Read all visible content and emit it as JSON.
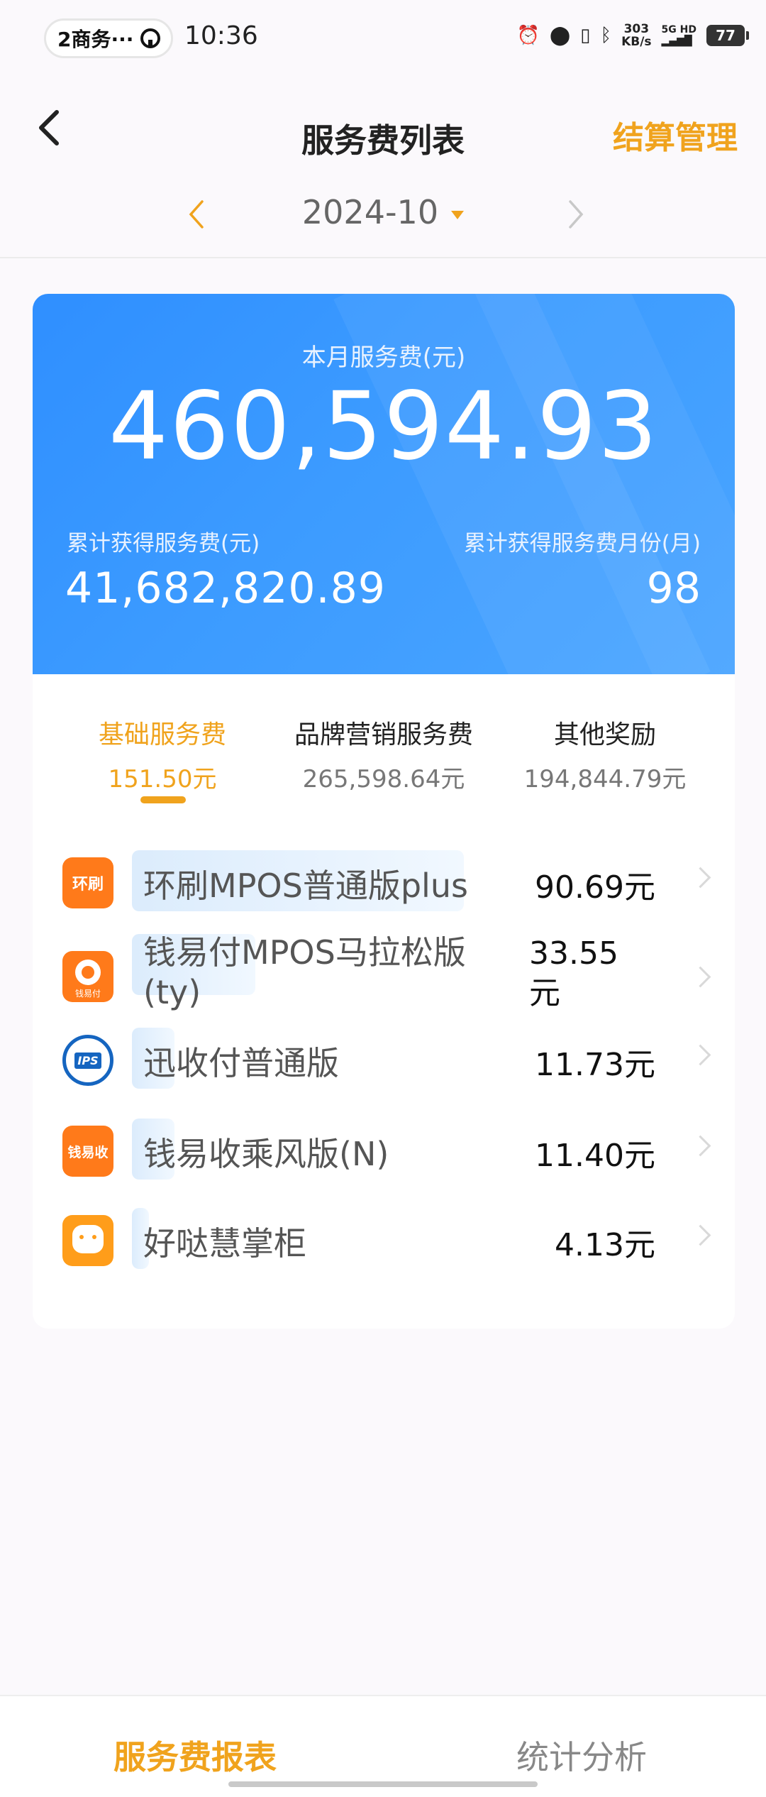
{
  "status_bar": {
    "pill_label": "2商务···",
    "time": "10:36",
    "net_speed_value": "303",
    "net_speed_unit": "KB/s",
    "network": "5G HD",
    "battery": "77"
  },
  "header": {
    "title": "服务费列表",
    "right_action": "结算管理",
    "month": "2024-10"
  },
  "summary": {
    "month_fee_label": "本月服务费(元)",
    "month_fee_value": "460,594.93",
    "total_fee_label": "累计获得服务费(元)",
    "total_fee_value": "41,682,820.89",
    "total_months_label": "累计获得服务费月份(月)",
    "total_months_value": "98"
  },
  "tabs": [
    {
      "label": "基础服务费",
      "amount": "151.50元"
    },
    {
      "label": "品牌营销服务费",
      "amount": "265,598.64元"
    },
    {
      "label": "其他奖励",
      "amount": "194,844.79元"
    }
  ],
  "products": [
    {
      "name": "环刷MPOS普通版plus",
      "value": "90.69元",
      "logo_text": "环刷",
      "logo_color": "#ff7a1a",
      "bar_share": 0.78
    },
    {
      "name_line1": "钱易付MPOS马拉松版",
      "name_line2": "(ty)",
      "value_line1": "33.55",
      "value_line2": "元",
      "logo_text": "钱易付",
      "logo_color": "#ff7a1a",
      "bar_share": 0.29
    },
    {
      "name": "迅收付普通版",
      "value": "11.73元",
      "logo_text": "IPS",
      "logo_color": "#1565c0",
      "bar_share": 0.1
    },
    {
      "name": "钱易收乘风版(N)",
      "value": "11.40元",
      "logo_text": "钱易收",
      "logo_color": "#ff7a1a",
      "bar_share": 0.1
    },
    {
      "name": "好哒慧掌柜",
      "value": "4.13元",
      "logo_text": "",
      "logo_color": "#ff9d1a",
      "bar_share": 0.04
    }
  ],
  "bottom_nav": [
    {
      "label": "服务费报表",
      "active": true
    },
    {
      "label": "统计分析",
      "active": false
    }
  ],
  "colors": {
    "accent": "#f0a31d",
    "card_blue": "#3595ff"
  }
}
